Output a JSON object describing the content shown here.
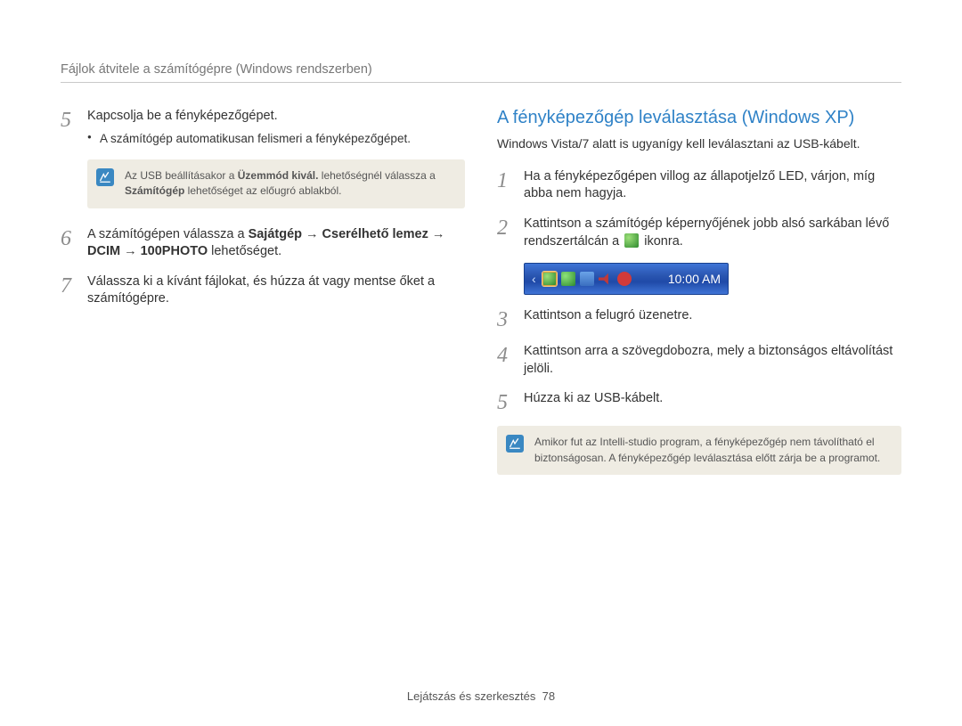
{
  "header": {
    "title": "Fájlok átvitele a számítógépre (Windows rendszerben)"
  },
  "left": {
    "step5": {
      "num": "5",
      "text": "Kapcsolja be a fényképezőgépet.",
      "sub": "A számítógép automatikusan felismeri a fényképezőgépet."
    },
    "note1": {
      "pre": "Az USB beállításakor a ",
      "b1": "Üzemmód kivál.",
      "mid": " lehetőségnél válassza a ",
      "b2": "Számítógép",
      "post": " lehetőséget az előugró ablakból."
    },
    "step6": {
      "num": "6",
      "pre": "A számítógépen válassza a ",
      "bold": "Sajátgép → Cserélhető lemez → DCIM → 100PHOTO",
      "post": " lehetőséget."
    },
    "step7": {
      "num": "7",
      "text": "Válassza ki a kívánt fájlokat, és húzza át vagy mentse őket a számítógépre."
    }
  },
  "right": {
    "title": "A fényképezőgép leválasztása (Windows XP)",
    "sub": "Windows Vista/7 alatt is ugyanígy kell leválasztani az USB-kábelt.",
    "step1": {
      "num": "1",
      "text": "Ha a fényképezőgépen villog az állapotjelző LED, várjon, míg abba nem hagyja."
    },
    "step2": {
      "num": "2",
      "pre": "Kattintson a számítógép képernyőjének jobb alsó sarkában lévő rendszertálcán a ",
      "post": " ikonra."
    },
    "taskbar": {
      "clock": "10:00 AM"
    },
    "step3": {
      "num": "3",
      "text": "Kattintson a felugró üzenetre."
    },
    "step4": {
      "num": "4",
      "text": "Kattintson arra a szövegdobozra, mely a biztonságos eltávolítást jelöli."
    },
    "step5": {
      "num": "5",
      "text": "Húzza ki az USB-kábelt."
    },
    "note2": "Amikor fut az Intelli-studio program, a fényképezőgép nem távolítható el biztonságosan. A fényképezőgép leválasztása előtt zárja be a programot."
  },
  "footer": {
    "section": "Lejátszás és szerkesztés",
    "page": "78"
  }
}
